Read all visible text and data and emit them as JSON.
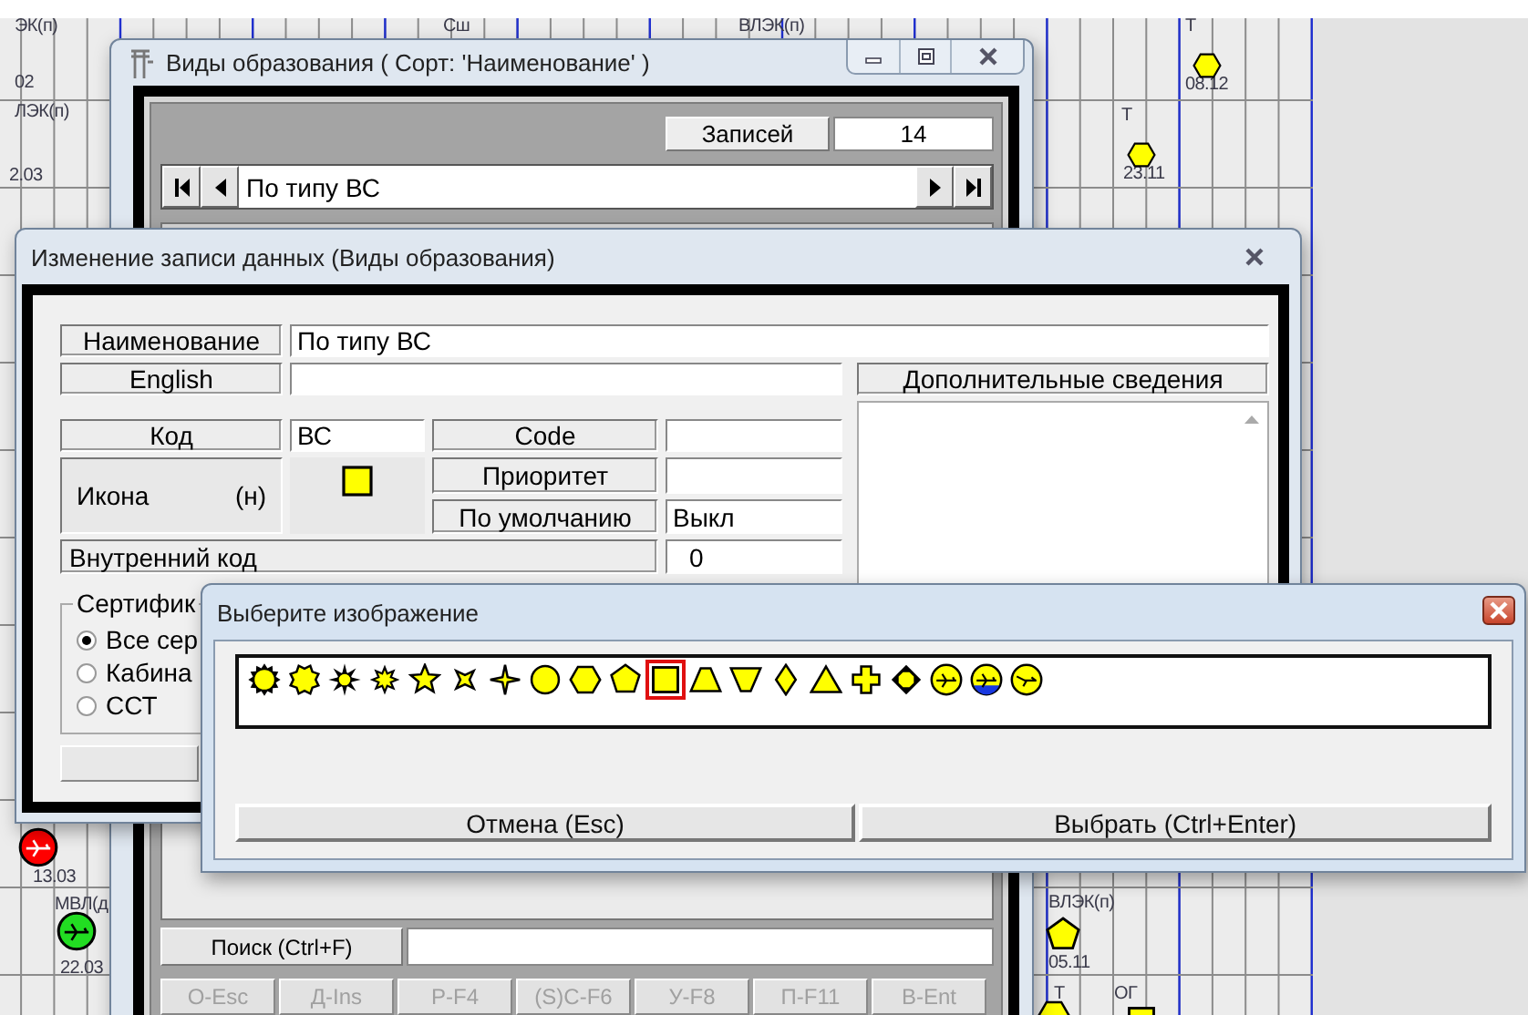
{
  "schedule": {
    "labels": [
      "ЭК(п)",
      "02",
      "ЛЭК(п)",
      "2.03",
      "Сш",
      "ВЛЭК(п)",
      "Т",
      "08.12",
      "Т",
      "23.11",
      "13.03",
      "МВЛ(д",
      "22.03",
      "ВЛЭК(п)",
      "05.11",
      "Т",
      "ОГ"
    ],
    "markers": [
      {
        "kind": "hexagon",
        "color": "#ffff00"
      },
      {
        "kind": "hexagon",
        "color": "#ffff00"
      },
      {
        "kind": "plane-circle",
        "color": "#ff0000"
      },
      {
        "kind": "plane-circle",
        "color": "#22dd22"
      },
      {
        "kind": "pentagon",
        "color": "#ffff00"
      },
      {
        "kind": "hexagon",
        "color": "#ffff00"
      },
      {
        "kind": "square",
        "color": "#ffff00"
      }
    ]
  },
  "list_window": {
    "title": "Виды образования ( Сорт: 'Наименование' )",
    "records_label": "Записей",
    "records_count": "14",
    "current_record": "По типу ВС",
    "search_button": "Поиск (Ctrl+F)",
    "buttons": [
      {
        "label": "О-Esc",
        "disabled": true
      },
      {
        "label": "Д-Ins",
        "disabled": true
      },
      {
        "label": "Р-F4",
        "disabled": true
      },
      {
        "label": "(S)C-F6",
        "disabled": true
      },
      {
        "label": "У-F8",
        "disabled": true
      },
      {
        "label": "П-F11",
        "disabled": true
      },
      {
        "label": "В-Ent",
        "disabled": true
      }
    ]
  },
  "edit_window": {
    "title": "Изменение записи данных  (Виды образования)",
    "name": {
      "label": "Наименование",
      "value": "По типу ВС"
    },
    "english": {
      "label": "English"
    },
    "code": {
      "label": "Код",
      "value": "ВС"
    },
    "code_en": {
      "label": "Code"
    },
    "icon": {
      "label": "Икона",
      "hint": "(н)",
      "kind": "square"
    },
    "priority": {
      "label": "Приоритет"
    },
    "default": {
      "label": "По умолчанию",
      "value": "Выкл"
    },
    "internal_code": {
      "label": "Внутренний код",
      "value": "0"
    },
    "notes": {
      "label": "Дополнительные сведения"
    },
    "certification": {
      "label": "Сертифик",
      "options": [
        {
          "label": "Все сер",
          "selected": true
        },
        {
          "label": "Кабина",
          "selected": false
        },
        {
          "label": "ССТ",
          "selected": false
        }
      ]
    }
  },
  "picker_window": {
    "title": "Выберите изображение",
    "icons": [
      {
        "kind": "sun",
        "selected": false
      },
      {
        "kind": "octagram",
        "selected": false
      },
      {
        "kind": "burst",
        "selected": false
      },
      {
        "kind": "small-burst",
        "selected": false
      },
      {
        "kind": "star",
        "selected": false
      },
      {
        "kind": "cross-star",
        "selected": false
      },
      {
        "kind": "four-point-star",
        "selected": false
      },
      {
        "kind": "circle",
        "selected": false
      },
      {
        "kind": "hexagon",
        "selected": false
      },
      {
        "kind": "pentagon",
        "selected": false
      },
      {
        "kind": "square",
        "selected": true
      },
      {
        "kind": "trapezoid",
        "selected": false
      },
      {
        "kind": "inverted-trapezoid",
        "selected": false
      },
      {
        "kind": "diamond",
        "selected": false
      },
      {
        "kind": "triangle",
        "selected": false
      },
      {
        "kind": "cross",
        "selected": false
      },
      {
        "kind": "diamond-octagon",
        "selected": false
      },
      {
        "kind": "plane-circle",
        "selected": false
      },
      {
        "kind": "plane-water-circle",
        "selected": false
      },
      {
        "kind": "plane-arrow-circle",
        "selected": false
      }
    ],
    "buttons": [
      {
        "label": "Отмена (Esc)"
      },
      {
        "label": "Выбрать (Ctrl+Enter)"
      }
    ]
  }
}
